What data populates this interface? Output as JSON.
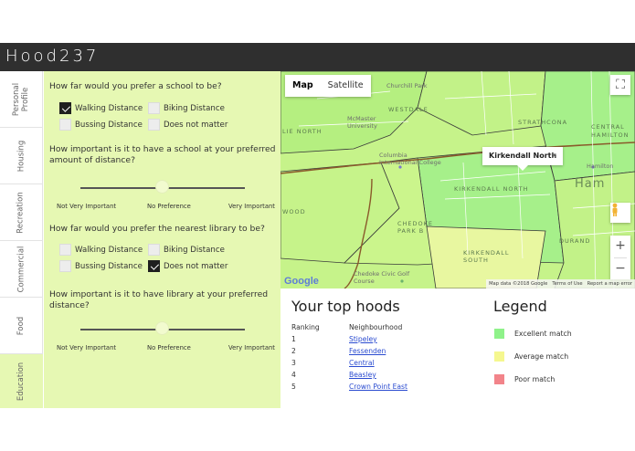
{
  "app": {
    "title": "Hood237"
  },
  "sidebar": {
    "tabs": [
      {
        "label": "Personal Profile",
        "active": false
      },
      {
        "label": "Housing",
        "active": false
      },
      {
        "label": "Recreation",
        "active": false
      },
      {
        "label": "Commercial",
        "active": false
      },
      {
        "label": "Food",
        "active": false
      },
      {
        "label": "Education",
        "active": true
      }
    ]
  },
  "questions": {
    "school_distance": {
      "question": "How far would you prefer a school to be?",
      "options": [
        {
          "label": "Walking Distance",
          "checked": true
        },
        {
          "label": "Biking Distance",
          "checked": false
        },
        {
          "label": "Bussing Distance",
          "checked": false
        },
        {
          "label": "Does not matter",
          "checked": false
        }
      ]
    },
    "school_importance": {
      "question": "How important is it to have a school at your preferred amount of distance?",
      "slider_value": 0.5,
      "labels": {
        "low": "Not Very Important",
        "mid": "No Preference",
        "high": "Very Important"
      }
    },
    "library_distance": {
      "question": "How far would you prefer the nearest library to be?",
      "options": [
        {
          "label": "Walking Distance",
          "checked": false
        },
        {
          "label": "Biking Distance",
          "checked": false
        },
        {
          "label": "Bussing Distance",
          "checked": false
        },
        {
          "label": "Does not matter",
          "checked": true
        }
      ]
    },
    "library_importance": {
      "question": "How important is it to have library at your preferred distance?",
      "slider_value": 0.5,
      "labels": {
        "low": "Not Very Important",
        "mid": "No Preference",
        "high": "Very Important"
      }
    }
  },
  "map": {
    "type_options": [
      "Map",
      "Satellite"
    ],
    "selected_type": "Map",
    "info_window": "Kirkendall North",
    "info_close": "×",
    "zoom_in": "+",
    "zoom_out": "−",
    "place_labels": [
      "Churchill Park",
      "WESTDALE",
      "McMaster University",
      "LIE NORTH",
      "Columbia International College",
      "STRATHCONA",
      "CENTRAL",
      "HAMILTON",
      "Hamilton",
      "KIRKENDALL NORTH",
      "CHEDOKE PARK B",
      "WOOD",
      "KIRKENDALL SOUTH",
      "DURAND",
      "Chedoke Civic Golf Course",
      "Ham"
    ],
    "footer": [
      "Map data ©2018 Google",
      "Terms of Use",
      "Report a map error"
    ],
    "logo": "Google",
    "colors": {
      "excellent": "#a6f08a",
      "average": "#e8f7a0",
      "base": "#c6f38a"
    }
  },
  "tophoods": {
    "title": "Your top hoods",
    "headers": {
      "rank": "Ranking",
      "hood": "Neighbourhood"
    },
    "rows": [
      {
        "rank": "1",
        "name": "Stipeley"
      },
      {
        "rank": "2",
        "name": "Fessenden"
      },
      {
        "rank": "3",
        "name": "Central"
      },
      {
        "rank": "4",
        "name": "Beasley"
      },
      {
        "rank": "5",
        "name": "Crown Point East"
      }
    ]
  },
  "legend": {
    "title": "Legend",
    "items": [
      {
        "label": "Excellent match",
        "color": "#8ff28a"
      },
      {
        "label": "Average match",
        "color": "#f5f78f"
      },
      {
        "label": "Poor match",
        "color": "#f2848a"
      }
    ]
  }
}
